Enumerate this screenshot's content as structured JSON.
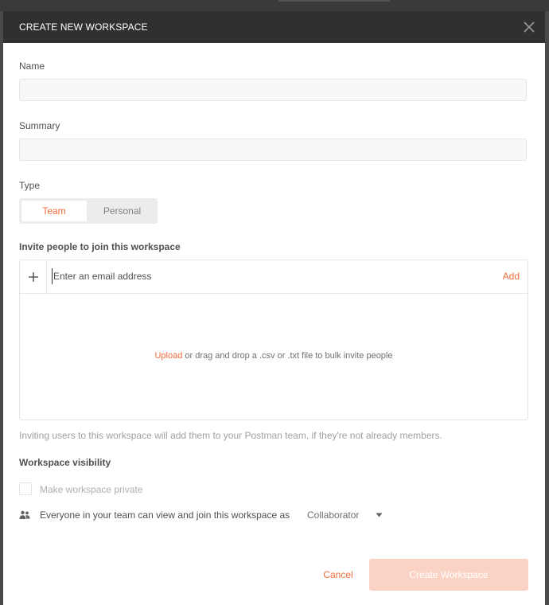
{
  "modal": {
    "title": "CREATE NEW WORKSPACE"
  },
  "form": {
    "name_label": "Name",
    "name_value": "",
    "summary_label": "Summary",
    "summary_value": "",
    "type_label": "Type",
    "type_options": [
      "Team",
      "Personal"
    ],
    "type_selected": "Team",
    "invite_label": "Invite people to join this workspace",
    "email_placeholder": "Enter an email address",
    "add_label": "Add",
    "upload_link": "Upload",
    "bulk_text": " or drag and drop a .csv or .txt file to bulk invite people",
    "helper_text": "Inviting users to this workspace will add them to your Postman team, if they're not already members.",
    "visibility_label": "Workspace visibility",
    "private_checkbox_label": "Make workspace private",
    "private_checked": false,
    "team_access_text": "Everyone in your team can view and join this workspace as",
    "role_selected": "Collaborator"
  },
  "footer": {
    "cancel_label": "Cancel",
    "create_label": "Create Workspace"
  },
  "icons": {
    "close": "close-icon",
    "plus": "plus-icon",
    "people": "people-icon",
    "caret": "caret-down-icon"
  },
  "colors": {
    "accent": "#f26b3a",
    "accent_disabled": "#fbd3c4",
    "header_bg": "#303030"
  }
}
